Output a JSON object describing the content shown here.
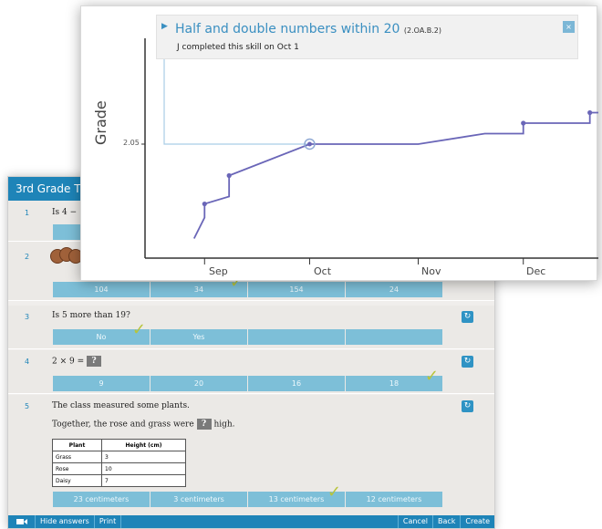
{
  "worksheet": {
    "title": "3rd Grade T",
    "questions": [
      {
        "number": "1",
        "text": "Is 4 − ",
        "answers": []
      },
      {
        "number": "2",
        "text": "",
        "answers": [
          "104",
          "34",
          "154",
          "24"
        ],
        "correct_index": 1
      },
      {
        "number": "3",
        "text": "Is 5 more than 19?",
        "answers": [
          "No",
          "Yes",
          "",
          ""
        ],
        "correct_index": 0
      },
      {
        "number": "4",
        "text": "2 × 9 = ",
        "answers": [
          "9",
          "20",
          "16",
          "18"
        ],
        "correct_index": 3
      },
      {
        "number": "5",
        "text": "The class measured some plants.",
        "text2_pre": "Together, the rose and grass were",
        "text2_post": "high.",
        "answers": [
          "23 centimeters",
          "3 centimeters",
          "13 centimeters",
          "12 centimeters"
        ],
        "correct_index": 2
      }
    ],
    "qmark": "?",
    "table": {
      "headers": [
        "Plant",
        "Height (cm)"
      ],
      "rows": [
        [
          "Grass",
          "3"
        ],
        [
          "Rose",
          "10"
        ],
        [
          "Daisy",
          "7"
        ]
      ]
    },
    "footer": {
      "hide_answers": "Hide answers",
      "print": "Print",
      "cancel": "Cancel",
      "back": "Back",
      "create": "Create"
    }
  },
  "chart_popup": {
    "title": "Half and double numbers within 20",
    "code": "(2.OA.B.2)",
    "subtitle": "J completed this skill on Oct 1",
    "close": "×"
  },
  "chart_data": {
    "type": "line",
    "ylabel": "Grade",
    "y_tick_labels": [
      "2.05"
    ],
    "x_tick_labels": [
      "Sep",
      "Oct",
      "Nov",
      "Dec"
    ],
    "highlighted_point": {
      "x": "Oct 1",
      "y": 2.05
    },
    "series": [
      {
        "points": [
          [
            "Aug 29",
            1.96
          ],
          [
            "Sep 1",
            1.98
          ],
          [
            "Sep 1",
            1.993
          ],
          [
            "Sep 8",
            2.0
          ],
          [
            "Sep 8",
            2.02
          ],
          [
            "Oct 1",
            2.05
          ],
          [
            "Nov 1",
            2.05
          ],
          [
            "Nov 20",
            2.06
          ],
          [
            "Dec 1",
            2.06
          ],
          [
            "Dec 1",
            2.07
          ],
          [
            "Dec 20",
            2.07
          ],
          [
            "Dec 20",
            2.08
          ],
          [
            "Dec 31",
            2.08
          ]
        ],
        "color": "#6a66b8"
      }
    ],
    "colors": {
      "line": "#6a66b8",
      "guide": "#a9cde6",
      "axis": "#333333"
    }
  }
}
